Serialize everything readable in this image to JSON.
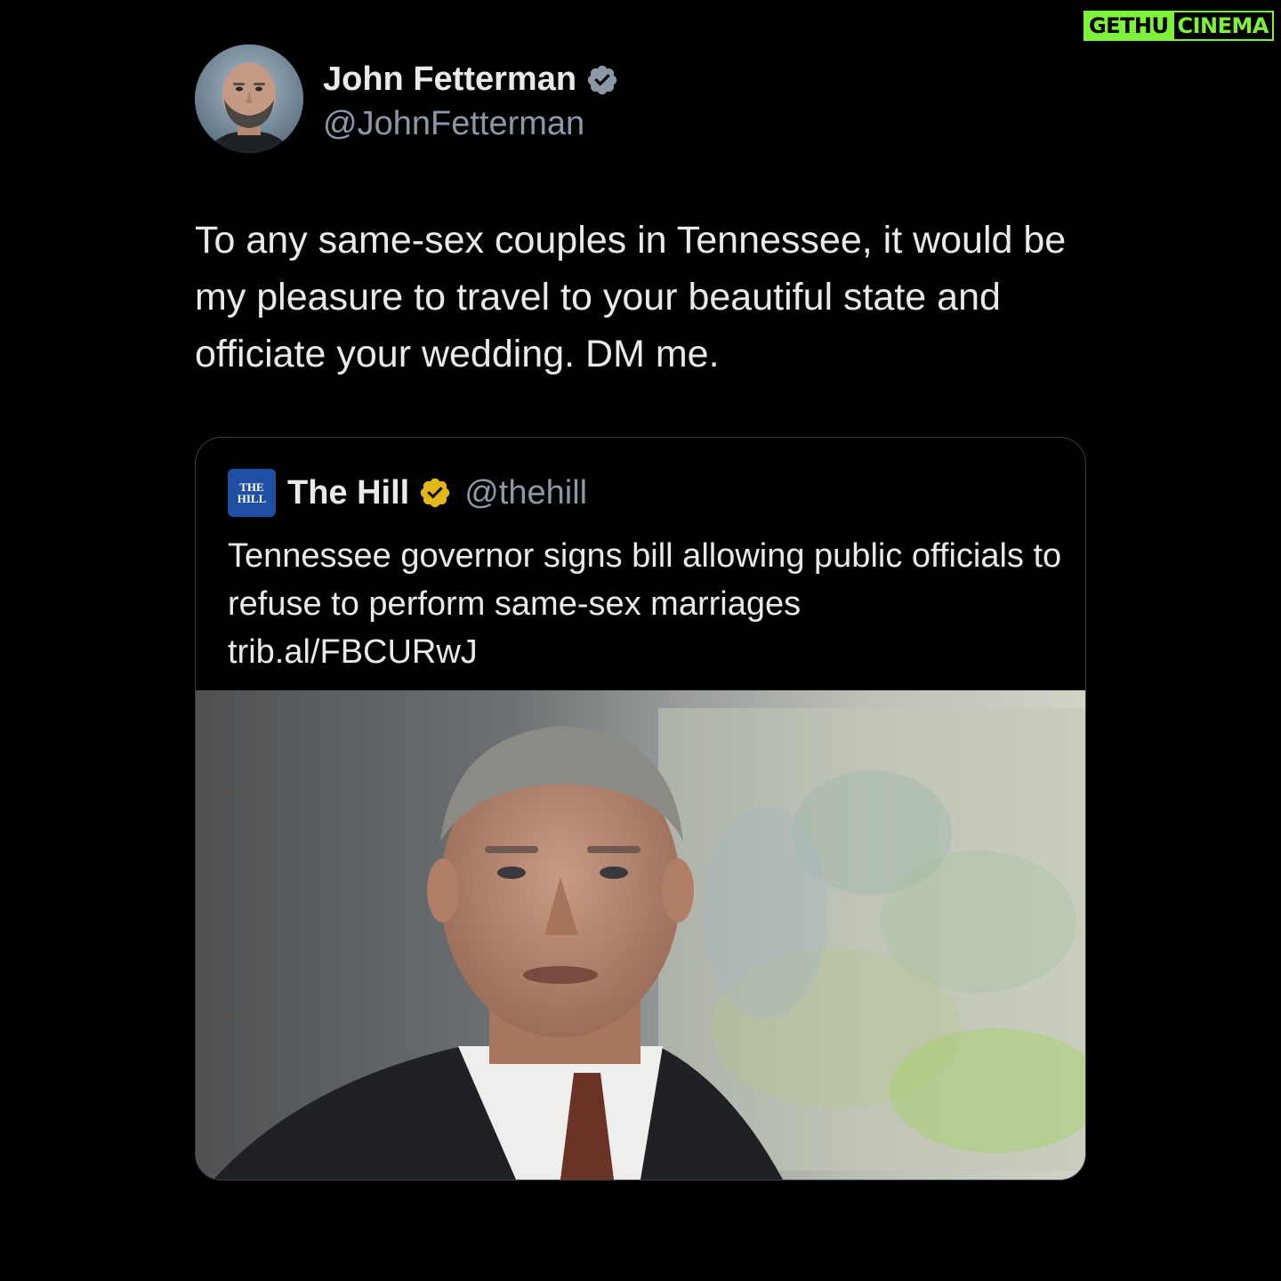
{
  "watermark": {
    "left": "GETHU",
    "right": "CINEMA"
  },
  "author": {
    "name": "John Fetterman",
    "handle": "@JohnFetterman",
    "verified": "verified-badge-icon",
    "avatar": "avatar-photo"
  },
  "tweet": {
    "text": "To any same-sex couples in Tennessee, it would be my pleasure to travel to your beautiful state and officiate your wedding. DM me."
  },
  "quote": {
    "logo_line1": "THE",
    "logo_line2": "HILL",
    "name": "The Hill",
    "badge": "gold-verified-badge-icon",
    "handle": "@thehill",
    "headline": "Tennessee governor signs bill allowing public officials to refuse to perform same-sex marriages",
    "link": "trib.al/FBCURwJ",
    "image": "governor-photo"
  },
  "colors": {
    "background": "#000000",
    "text": "#e7e9ea",
    "muted": "#8b98a5",
    "verified_blue": "#8b98a5",
    "gold": "#e2b719",
    "hill_blue": "#1f4fa3",
    "watermark_green": "#7ef23a"
  }
}
